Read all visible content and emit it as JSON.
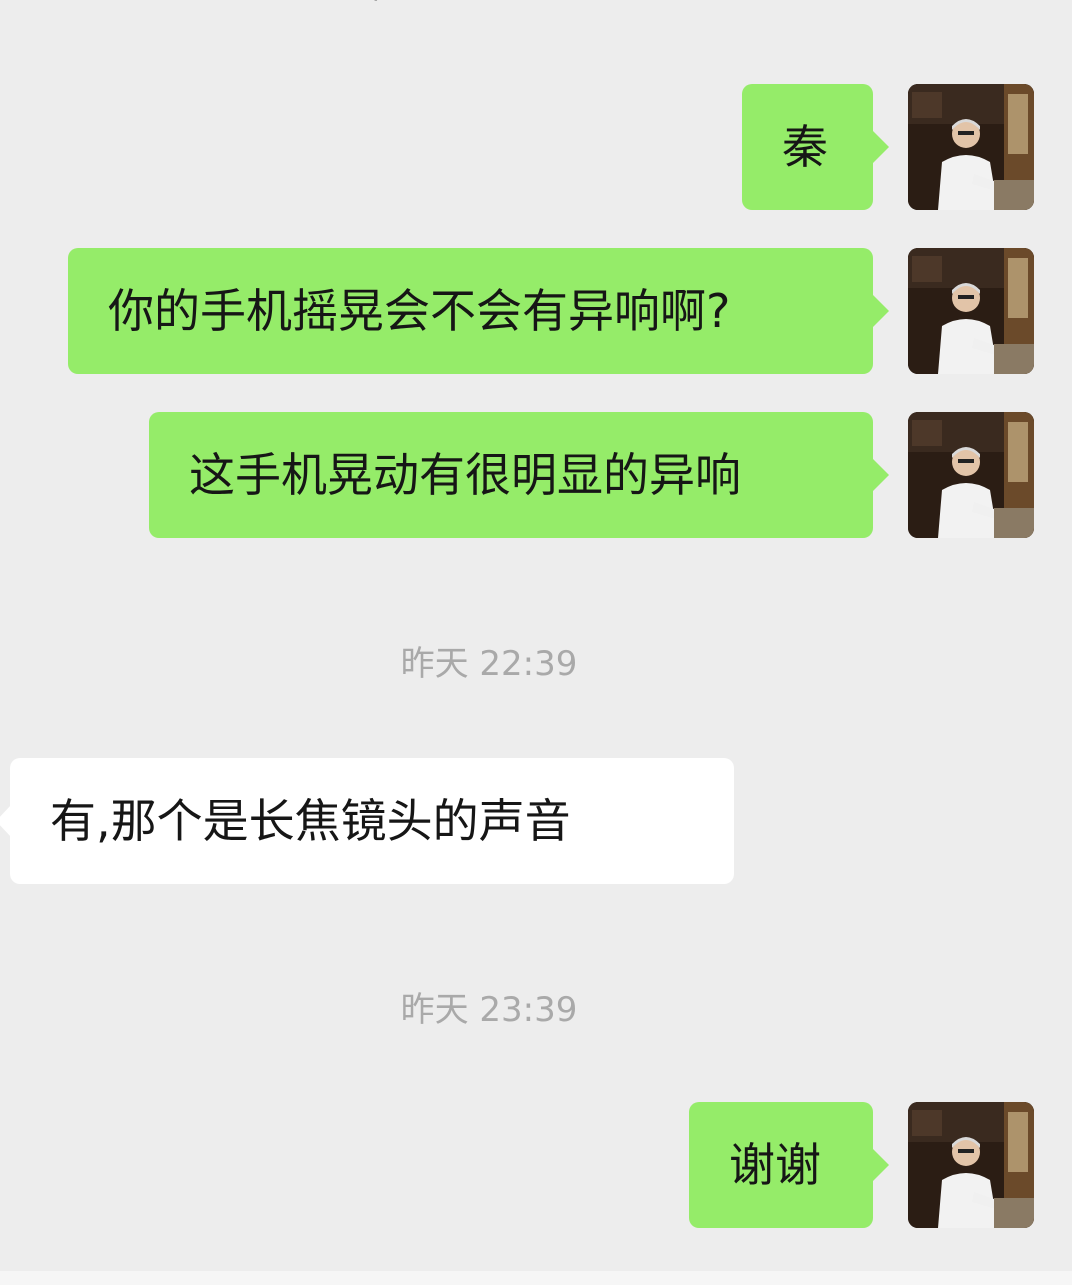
{
  "colors": {
    "background": "#ededed",
    "outgoing_bubble": "#95ec69",
    "incoming_bubble": "#ffffff",
    "timestamp_text": "#a9a9a9"
  },
  "avatar_icon": "user-photo-avatar",
  "messages": [
    {
      "direction": "out",
      "text": "秦"
    },
    {
      "direction": "out",
      "text": "你的手机摇晃会不会有异响啊?"
    },
    {
      "direction": "out",
      "text": "这手机晃动有很明显的异响"
    },
    {
      "direction": "in",
      "text": "有,那个是长焦镜头的声音"
    },
    {
      "direction": "out",
      "text": "谢谢"
    }
  ],
  "timestamps": [
    {
      "text": "昨天 22:39"
    },
    {
      "text": "昨天 23:39"
    }
  ]
}
